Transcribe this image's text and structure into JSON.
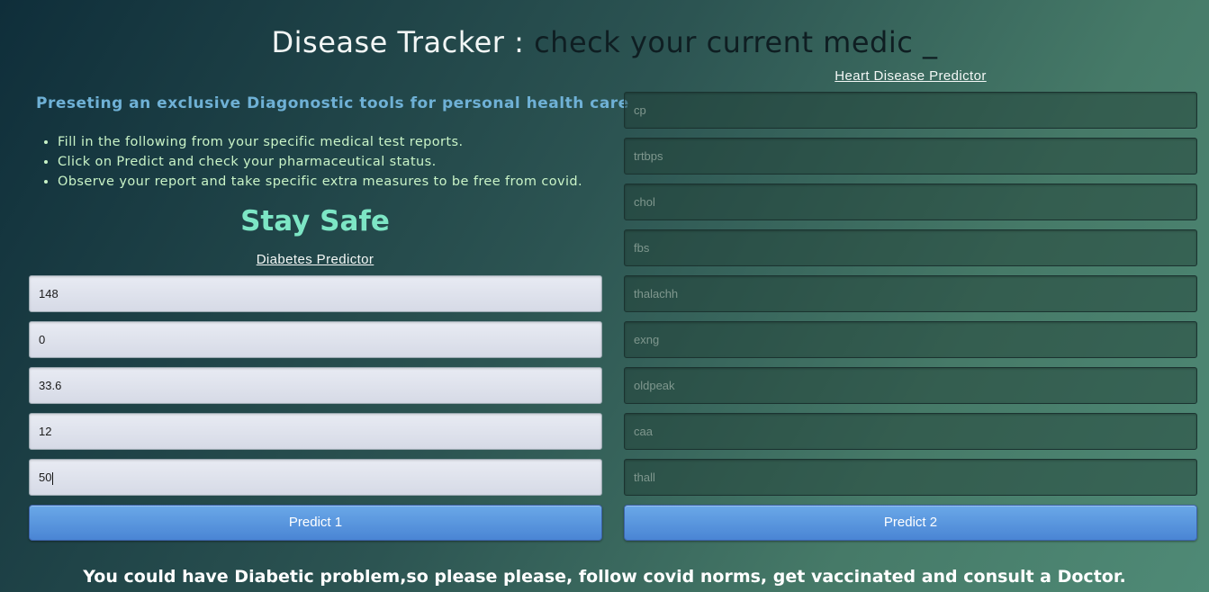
{
  "header": {
    "brand": "Disease Tracker",
    "separator": ":",
    "typed_text": "check your current medic",
    "cursor": "_"
  },
  "intro": {
    "tagline": "Preseting an exclusive Diagonostic tools for personal health care",
    "bullets": [
      "Fill in the following from your specific medical test reports.",
      "Click on Predict and check your pharmaceutical status.",
      "Observe your report and take specific extra measures to be free from covid."
    ],
    "stay_safe": "Stay Safe"
  },
  "diabetes": {
    "title": "Diabetes Predictor",
    "fields": [
      {
        "value": "148"
      },
      {
        "value": "0"
      },
      {
        "value": "33.6"
      },
      {
        "value": "12"
      },
      {
        "value": "50"
      }
    ],
    "button": "Predict 1"
  },
  "heart": {
    "title": "Heart Disease Predictor",
    "fields": [
      {
        "placeholder": "cp"
      },
      {
        "placeholder": "trtbps"
      },
      {
        "placeholder": "chol"
      },
      {
        "placeholder": "fbs"
      },
      {
        "placeholder": "thalachh"
      },
      {
        "placeholder": "exng"
      },
      {
        "placeholder": "oldpeak"
      },
      {
        "placeholder": "caa"
      },
      {
        "placeholder": "thall"
      }
    ],
    "button": "Predict 2"
  },
  "result": "You could have Diabetic problem,so please please, follow covid norms, get vaccinated and consult a Doctor."
}
